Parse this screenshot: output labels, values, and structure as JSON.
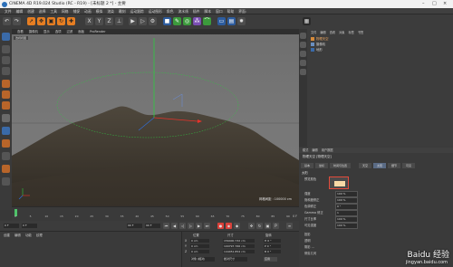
{
  "window": {
    "title": "CINEMA 4D R19.024 Studio (RC - R19) - [未标题 2 *] - 主要"
  },
  "menubar": [
    "文件",
    "编辑",
    "创建",
    "选择",
    "工具",
    "网格",
    "捕捉",
    "动画",
    "模拟",
    "渲染",
    "雕刻",
    "运动跟踪",
    "运动图形",
    "角色",
    "流水线",
    "插件",
    "脚本",
    "窗口",
    "帮助",
    "界面:"
  ],
  "viewport": {
    "menu": [
      "查看",
      "摄像机",
      "显示",
      "选项",
      "过滤",
      "面板",
      "ProRender"
    ],
    "tag": "透视视图",
    "grid_info": "网格间距 : 100000 cm"
  },
  "object_manager": {
    "menu": [
      "文件",
      "编辑",
      "查看",
      "对象",
      "标签",
      "书签"
    ],
    "objects": [
      "物理天空",
      "摄像机",
      "地形"
    ]
  },
  "attribute_manager": {
    "menu": [
      "模式",
      "编辑",
      "用户数据"
    ],
    "title": "物理天空 [物理天空]",
    "tabs": [
      "基本",
      "坐标",
      "时间与位置",
      "天空",
      "太阳",
      "细节",
      "可见"
    ],
    "active_tab": "太阳",
    "section": "太阳",
    "props": [
      {
        "label": "预览颜色",
        "value": ""
      },
      {
        "label": "强度",
        "value": "100 %"
      },
      {
        "label": "饱和度修正",
        "value": "100 %"
      },
      {
        "label": "色调修正",
        "value": "0 °"
      },
      {
        "label": "Gamma 修正",
        "value": "1"
      },
      {
        "label": "尺寸比率",
        "value": "100 %"
      },
      {
        "label": "可见强度",
        "value": "100 %"
      },
      {
        "label": "投影",
        "value": ""
      },
      {
        "label": "透明",
        "value": ""
      },
      {
        "label": "阴影 ...",
        "value": ""
      },
      {
        "label": "修剪几何",
        "value": ""
      }
    ],
    "preview_color": "#f7d9a6"
  },
  "timeline": {
    "ticks": [
      "0",
      "5",
      "10",
      "15",
      "20",
      "25",
      "30",
      "35",
      "40",
      "45",
      "50",
      "55",
      "60",
      "65",
      "70",
      "75",
      "80",
      "85",
      "90"
    ],
    "end_label": "0 F",
    "frame_start": "0 F",
    "frame_current": "0 F",
    "frame_end": "90 F",
    "frame_max": "90 F"
  },
  "materials": {
    "menu": [
      "创建",
      "编辑",
      "功能",
      "纹理"
    ]
  },
  "coordinates": {
    "headers": [
      "位置",
      "尺寸",
      "旋转"
    ],
    "rows": [
      {
        "axis": "X",
        "pos": "0 cm",
        "size": "156400.732 cm",
        "rot": "H 0 °"
      },
      {
        "axis": "Y",
        "pos": "0 cm",
        "size": "100797.766 cm",
        "rot": "P 0 °"
      },
      {
        "axis": "Z",
        "pos": "0 cm",
        "size": "144451.854 cm",
        "rot": "B 0 °"
      }
    ],
    "mode": "对象 (相对)",
    "mode2": "绝对尺寸",
    "apply": "应用"
  },
  "watermark": {
    "brand": "Baidu 经验",
    "url": "jingyan.baidu.com"
  },
  "colors": {
    "accent": "#e67e22",
    "highlight_box": "#e24b3b",
    "axis_green": "#2ecc40",
    "axis_red": "#e8322a"
  }
}
